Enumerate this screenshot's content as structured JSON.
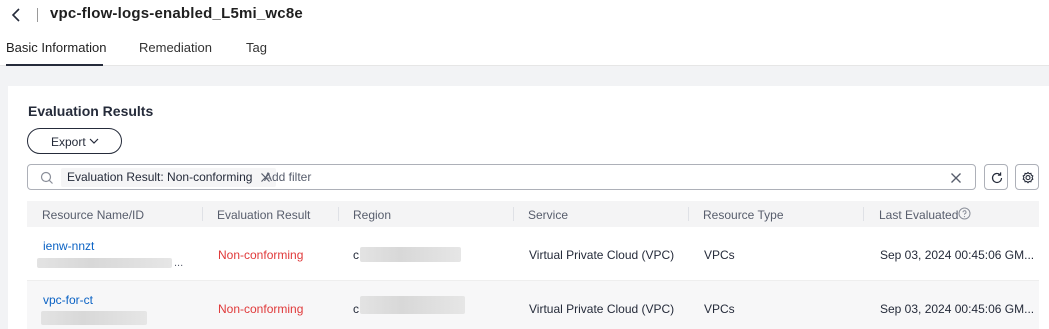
{
  "header": {
    "title": "vpc-flow-logs-enabled_L5mi_wc8e"
  },
  "tabs": [
    {
      "label": "Basic Information",
      "active": true
    },
    {
      "label": "Remediation",
      "active": false
    },
    {
      "label": "Tag",
      "active": false
    }
  ],
  "section": {
    "title": "Evaluation Results",
    "export_label": "Export"
  },
  "filter": {
    "tag_label": "Evaluation Result: Non-conforming",
    "placeholder": "Add filter"
  },
  "table": {
    "columns": [
      "Resource Name/ID",
      "Evaluation Result",
      "Region",
      "Service",
      "Resource Type",
      "Last Evaluated"
    ],
    "rows": [
      {
        "name": "ienw-nnzt",
        "result": "Non-conforming",
        "region_prefix": "c",
        "service": "Virtual Private Cloud (VPC)",
        "type": "VPCs",
        "last_evaluated": "Sep 03, 2024 00:45:06 GM..."
      },
      {
        "name": "vpc-for-ct",
        "result": "Non-conforming",
        "region_prefix": "c",
        "service": "Virtual Private Cloud (VPC)",
        "type": "VPCs",
        "last_evaluated": "Sep 03, 2024 00:45:06 GM..."
      }
    ],
    "id_ellipsis": "..."
  },
  "colors": {
    "non_conforming": "#e0393a",
    "link": "#0a62c4",
    "header_bg": "#f4f4f5"
  },
  "icons": [
    "back-arrow-icon",
    "chevron-down-icon",
    "search-icon",
    "close-icon",
    "clear-icon",
    "refresh-icon",
    "gear-icon",
    "help-icon"
  ]
}
